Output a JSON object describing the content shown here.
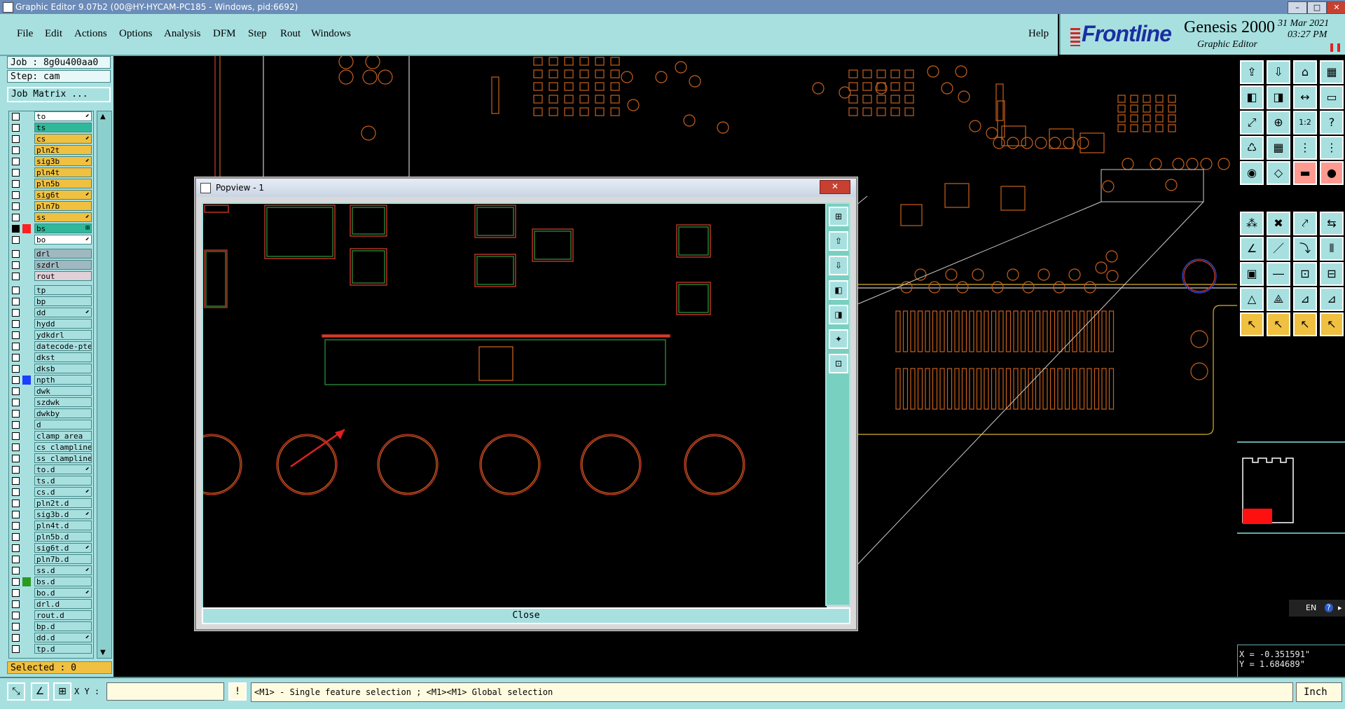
{
  "window": {
    "title": "Graphic Editor 9.07b2 (00@HY-HYCAM-PC185 - Windows, pid:6692)"
  },
  "menu": {
    "items": [
      "File",
      "Edit",
      "Actions",
      "Options",
      "Analysis",
      "DFM",
      "Step",
      "Rout",
      "Windows"
    ],
    "help": "Help"
  },
  "brand": {
    "logo": "Frontline",
    "product": "Genesis 2000",
    "subtitle": "Graphic Editor",
    "date": "31 Mar 2021",
    "time": "03:27 PM"
  },
  "job": {
    "job_label": "Job : 8g0u400aa0",
    "step_label": "Step: cam",
    "matrix_button": "Job Matrix ..."
  },
  "layers": [
    {
      "name": "to",
      "color": "#ffffff",
      "flag": "⬋"
    },
    {
      "name": "ts",
      "color": "#2fb89a",
      "flag": ""
    },
    {
      "name": "cs",
      "color": "#f0c040",
      "flag": "⬋"
    },
    {
      "name": "pln2t",
      "color": "#f0c040",
      "flag": ""
    },
    {
      "name": "sig3b",
      "color": "#f0c040",
      "flag": "⬋"
    },
    {
      "name": "pln4t",
      "color": "#f0c040",
      "flag": ""
    },
    {
      "name": "pln5b",
      "color": "#f0c040",
      "flag": ""
    },
    {
      "name": "sig6t",
      "color": "#f0c040",
      "flag": "⬋"
    },
    {
      "name": "pln7b",
      "color": "#f0c040",
      "flag": ""
    },
    {
      "name": "ss",
      "color": "#f0c040",
      "flag": "⬋"
    },
    {
      "name": "bs",
      "color": "#2fb89a",
      "flag": "⊞",
      "selected": "#ff2020",
      "checked": true
    },
    {
      "name": "bo",
      "color": "#ffffff",
      "flag": "⬋"
    },
    {
      "name": "drl",
      "color": "#a0b8c0",
      "flag": ""
    },
    {
      "name": "szdrl",
      "color": "#a0b8c0",
      "flag": ""
    },
    {
      "name": "rout",
      "color": "#e0d0d8",
      "flag": ""
    },
    {
      "name": "tp",
      "color": "#a8e0e0",
      "flag": ""
    },
    {
      "name": "bp",
      "color": "#a8e0e0",
      "flag": ""
    },
    {
      "name": "dd",
      "color": "#a8e0e0",
      "flag": "⬋"
    },
    {
      "name": "hydd",
      "color": "#a8e0e0",
      "flag": ""
    },
    {
      "name": "ydkdrl",
      "color": "#a8e0e0",
      "flag": ""
    },
    {
      "name": "datecode-pte",
      "color": "#a8e0e0",
      "flag": ""
    },
    {
      "name": "dkst",
      "color": "#a8e0e0",
      "flag": ""
    },
    {
      "name": "dksb",
      "color": "#a8e0e0",
      "flag": ""
    },
    {
      "name": "npth",
      "color": "#a8e0e0",
      "flag": "",
      "selected": "#1b3fff"
    },
    {
      "name": "dwk",
      "color": "#a8e0e0",
      "flag": ""
    },
    {
      "name": "szdwk",
      "color": "#a8e0e0",
      "flag": ""
    },
    {
      "name": "dwkby",
      "color": "#a8e0e0",
      "flag": ""
    },
    {
      "name": "d",
      "color": "#a8e0e0",
      "flag": ""
    },
    {
      "name": "clamp_area",
      "color": "#a8e0e0",
      "flag": ""
    },
    {
      "name": "cs_clamplines",
      "color": "#a8e0e0",
      "flag": ""
    },
    {
      "name": "ss_clamplines",
      "color": "#a8e0e0",
      "flag": ""
    },
    {
      "name": "to.d",
      "color": "#a8e0e0",
      "flag": "⬋"
    },
    {
      "name": "ts.d",
      "color": "#a8e0e0",
      "flag": ""
    },
    {
      "name": "cs.d",
      "color": "#a8e0e0",
      "flag": "⬋"
    },
    {
      "name": "pln2t.d",
      "color": "#a8e0e0",
      "flag": ""
    },
    {
      "name": "sig3b.d",
      "color": "#a8e0e0",
      "flag": "⬋"
    },
    {
      "name": "pln4t.d",
      "color": "#a8e0e0",
      "flag": ""
    },
    {
      "name": "pln5b.d",
      "color": "#a8e0e0",
      "flag": ""
    },
    {
      "name": "sig6t.d",
      "color": "#a8e0e0",
      "flag": "⬋"
    },
    {
      "name": "pln7b.d",
      "color": "#a8e0e0",
      "flag": ""
    },
    {
      "name": "ss.d",
      "color": "#a8e0e0",
      "flag": "⬋"
    },
    {
      "name": "bs.d",
      "color": "#a8e0e0",
      "flag": "",
      "selected": "#2a9a20"
    },
    {
      "name": "bo.d",
      "color": "#a8e0e0",
      "flag": "⬋"
    },
    {
      "name": "drl.d",
      "color": "#a8e0e0",
      "flag": ""
    },
    {
      "name": "rout.d",
      "color": "#a8e0e0",
      "flag": ""
    },
    {
      "name": "bp.d",
      "color": "#a8e0e0",
      "flag": ""
    },
    {
      "name": "dd.d",
      "color": "#a8e0e0",
      "flag": "⬋"
    },
    {
      "name": "tp.d",
      "color": "#a8e0e0",
      "flag": ""
    }
  ],
  "selected_count": "Selected : 0",
  "popview": {
    "title": "Popview - 1",
    "close_x": "✕",
    "close_button": "Close"
  },
  "coords": {
    "x": "X = -0.351591\"",
    "y": "Y =  1.684689\""
  },
  "bottom": {
    "xy_label": "X Y :",
    "xy_value": "",
    "message": "<M1> - Single feature selection ; <M1><M1> Global selection",
    "units": "Inch",
    "alert_icon": "!"
  },
  "ime": {
    "label": "EN"
  }
}
